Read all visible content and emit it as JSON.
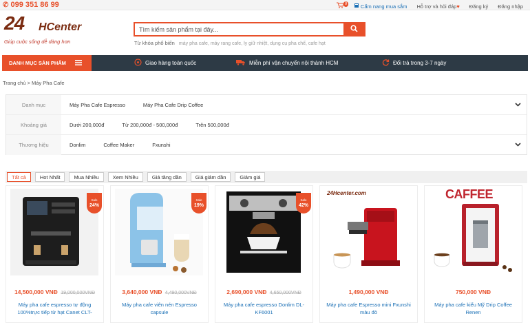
{
  "topbar": {
    "hotline": "099 351 86 99",
    "cart_count": "0",
    "links": [
      "Cẩm nang mua sắm",
      "Hỗ trợ và hỏi đáp",
      "Đăng ký",
      "Đăng nhập"
    ]
  },
  "header": {
    "logo_main": "24",
    "logo_h": "HCenter",
    "logo_tagline": "Giúp cuộc sống dễ dàng hơn",
    "search_placeholder": "Tìm kiếm sản phẩm tại đây...",
    "popular_label": "Từ khóa phổ biến",
    "popular_tags": "máy pha cafe, máy rang cafe, ly giữ nhiệt, dụng cụ pha chế, cafe hạt"
  },
  "navbar": {
    "category_label": "DANH MỤC SẢN PHẨM",
    "features": [
      "Giao hàng toàn quốc",
      "Miễn phí vận chuyển nội thành HCM",
      "Đổi trả trong 3-7 ngày"
    ]
  },
  "breadcrumb": "Trang chủ > Máy Pha Cafe",
  "filters": [
    {
      "label": "Danh mục",
      "options": [
        "Máy Pha Cafe Espresso",
        "Máy Pha Cafe Drip Coffee"
      ]
    },
    {
      "label": "Khoảng giá",
      "options": [
        "Dưới 200,000đ",
        "Từ 200,000đ - 500,000đ",
        "Trên 500,000đ"
      ]
    },
    {
      "label": "Thương hiệu",
      "options": [
        "Donlim",
        "Coffee Maker",
        "Fxunshi"
      ]
    }
  ],
  "sort_options": [
    "Tất cả",
    "Hot Nhất",
    "Mua Nhiều",
    "Xem Nhiều",
    "Giá tăng dần",
    "Giá giảm dần",
    "Giảm giá"
  ],
  "colors": {
    "accent": "#e8502a",
    "nav_dark": "#2d3a45",
    "link": "#1a6fb5"
  },
  "products": [
    {
      "price": "14,500,000 VNĐ",
      "old_price": "19,000,000VNĐ",
      "sale": "24%",
      "sale_label": "Sale",
      "name": "Máy pha cafe espresso tự động 100%trực tiếp từ hạt Canet CLT-"
    },
    {
      "price": "3,640,000 VNĐ",
      "old_price": "4,490,000VNĐ",
      "sale": "19%",
      "sale_label": "Sale",
      "name": "Máy pha cafe viên nén Espresso capsule"
    },
    {
      "price": "2,690,000 VNĐ",
      "old_price": "4,650,000VNĐ",
      "sale": "42%",
      "sale_label": "Sale",
      "name": "Máy pha cafe espresso Donlim DL-KF6001"
    },
    {
      "price": "1,490,000 VNĐ",
      "old_price": "",
      "sale": "",
      "sale_label": "",
      "name": "Máy pha cafe Espresso mini Fxunshi màu đỏ",
      "watermark": "24Hcenter.com"
    },
    {
      "price": "750,000 VNĐ",
      "old_price": "",
      "sale": "",
      "sale_label": "",
      "name": "Máy pha cafe kiểu Mỹ Drip Coffee Renen",
      "brand_text": "CAFFEE"
    }
  ]
}
